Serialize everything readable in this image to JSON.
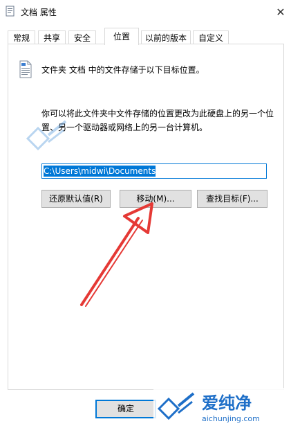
{
  "window": {
    "title": "文档 属性",
    "close_glyph": "✕"
  },
  "tabs": [
    {
      "label": "常规"
    },
    {
      "label": "共享"
    },
    {
      "label": "安全"
    },
    {
      "label": "位置"
    },
    {
      "label": "以前的版本"
    },
    {
      "label": "自定义"
    }
  ],
  "location": {
    "folder_description": "文件夹 文档 中的文件存储于以下目标位置。",
    "explanation": "你可以将此文件夹中文件存储的位置更改为此硬盘上的另一个位置、另一个驱动器或网络上的另一台计算机。",
    "path_value": "C:\\Users\\midwi\\Documents",
    "restore_default_label": "还原默认值(R)",
    "move_label": "移动(M)...",
    "find_target_label": "查找目标(F)..."
  },
  "footer": {
    "ok_label": "确定"
  },
  "watermark": {
    "brand": "爱纯净",
    "url": "aichunjing.com"
  },
  "colors": {
    "accent": "#0078d7",
    "arrow": "#e53935",
    "button_bg": "#e1e1e1"
  }
}
